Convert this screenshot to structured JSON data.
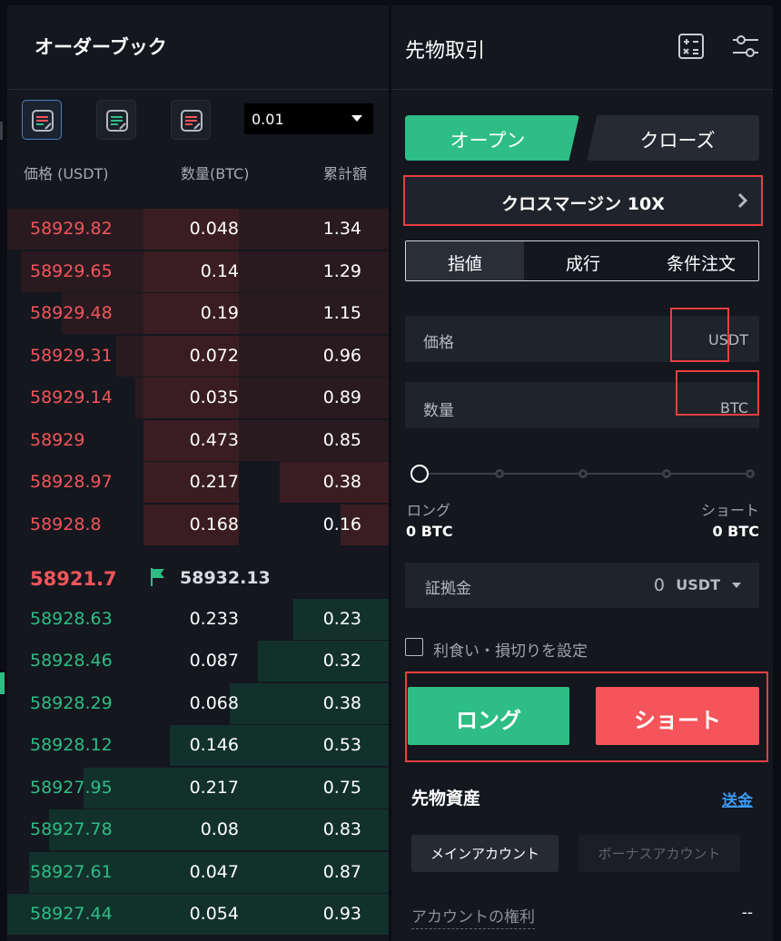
{
  "orderbook": {
    "title": "オーダーブック",
    "precision": "0.01",
    "col_price": "価格 (USDT)",
    "col_qty": "数量(BTC)",
    "col_total": "累計額",
    "asks": [
      {
        "price": "58929.82",
        "qty": "0.048",
        "total": "1.34"
      },
      {
        "price": "58929.65",
        "qty": "0.14",
        "total": "1.29"
      },
      {
        "price": "58929.48",
        "qty": "0.19",
        "total": "1.15"
      },
      {
        "price": "58929.31",
        "qty": "0.072",
        "total": "0.96"
      },
      {
        "price": "58929.14",
        "qty": "0.035",
        "total": "0.89"
      },
      {
        "price": "58929",
        "qty": "0.473",
        "total": "0.85"
      },
      {
        "price": "58928.97",
        "qty": "0.217",
        "total": "0.38"
      },
      {
        "price": "58928.8",
        "qty": "0.168",
        "total": "0.16"
      }
    ],
    "last_price": "58921.7",
    "mark_price": "58932.13",
    "bids": [
      {
        "price": "58928.63",
        "qty": "0.233",
        "total": "0.23"
      },
      {
        "price": "58928.46",
        "qty": "0.087",
        "total": "0.32"
      },
      {
        "price": "58928.29",
        "qty": "0.068",
        "total": "0.38"
      },
      {
        "price": "58928.12",
        "qty": "0.146",
        "total": "0.53"
      },
      {
        "price": "58927.95",
        "qty": "0.217",
        "total": "0.75"
      },
      {
        "price": "58927.78",
        "qty": "0.08",
        "total": "0.83"
      },
      {
        "price": "58927.61",
        "qty": "0.047",
        "total": "0.87"
      },
      {
        "price": "58927.44",
        "qty": "0.054",
        "total": "0.93"
      }
    ]
  },
  "futures": {
    "title": "先物取引",
    "tab_open": "オープン",
    "tab_close": "クローズ",
    "margin_mode": "クロスマージン 10X",
    "order_types": [
      "指値",
      "成行",
      "条件注文"
    ],
    "price_label": "価格",
    "price_unit": "USDT",
    "qty_label": "数量",
    "qty_unit": "BTC",
    "long_label": "ロング",
    "short_label": "ショート",
    "long_value": "0 BTC",
    "short_value": "0 BTC",
    "deposit_label": "証拠金",
    "deposit_amount": "0",
    "deposit_currency": "USDT",
    "tpsl_label": "利食い・損切りを設定",
    "btn_long": "ロング",
    "btn_short": "ショート",
    "assets_title": "先物資産",
    "transfer": "送金",
    "account_main": "メインアカウント",
    "account_bonus": "ボーナスアカウント",
    "equity_label": "アカウントの権利",
    "equity_value": "--"
  },
  "colors": {
    "buy": "#2ebd85",
    "sell": "#f2555a",
    "highlight": "#e8403d",
    "link": "#3d9bf5"
  }
}
